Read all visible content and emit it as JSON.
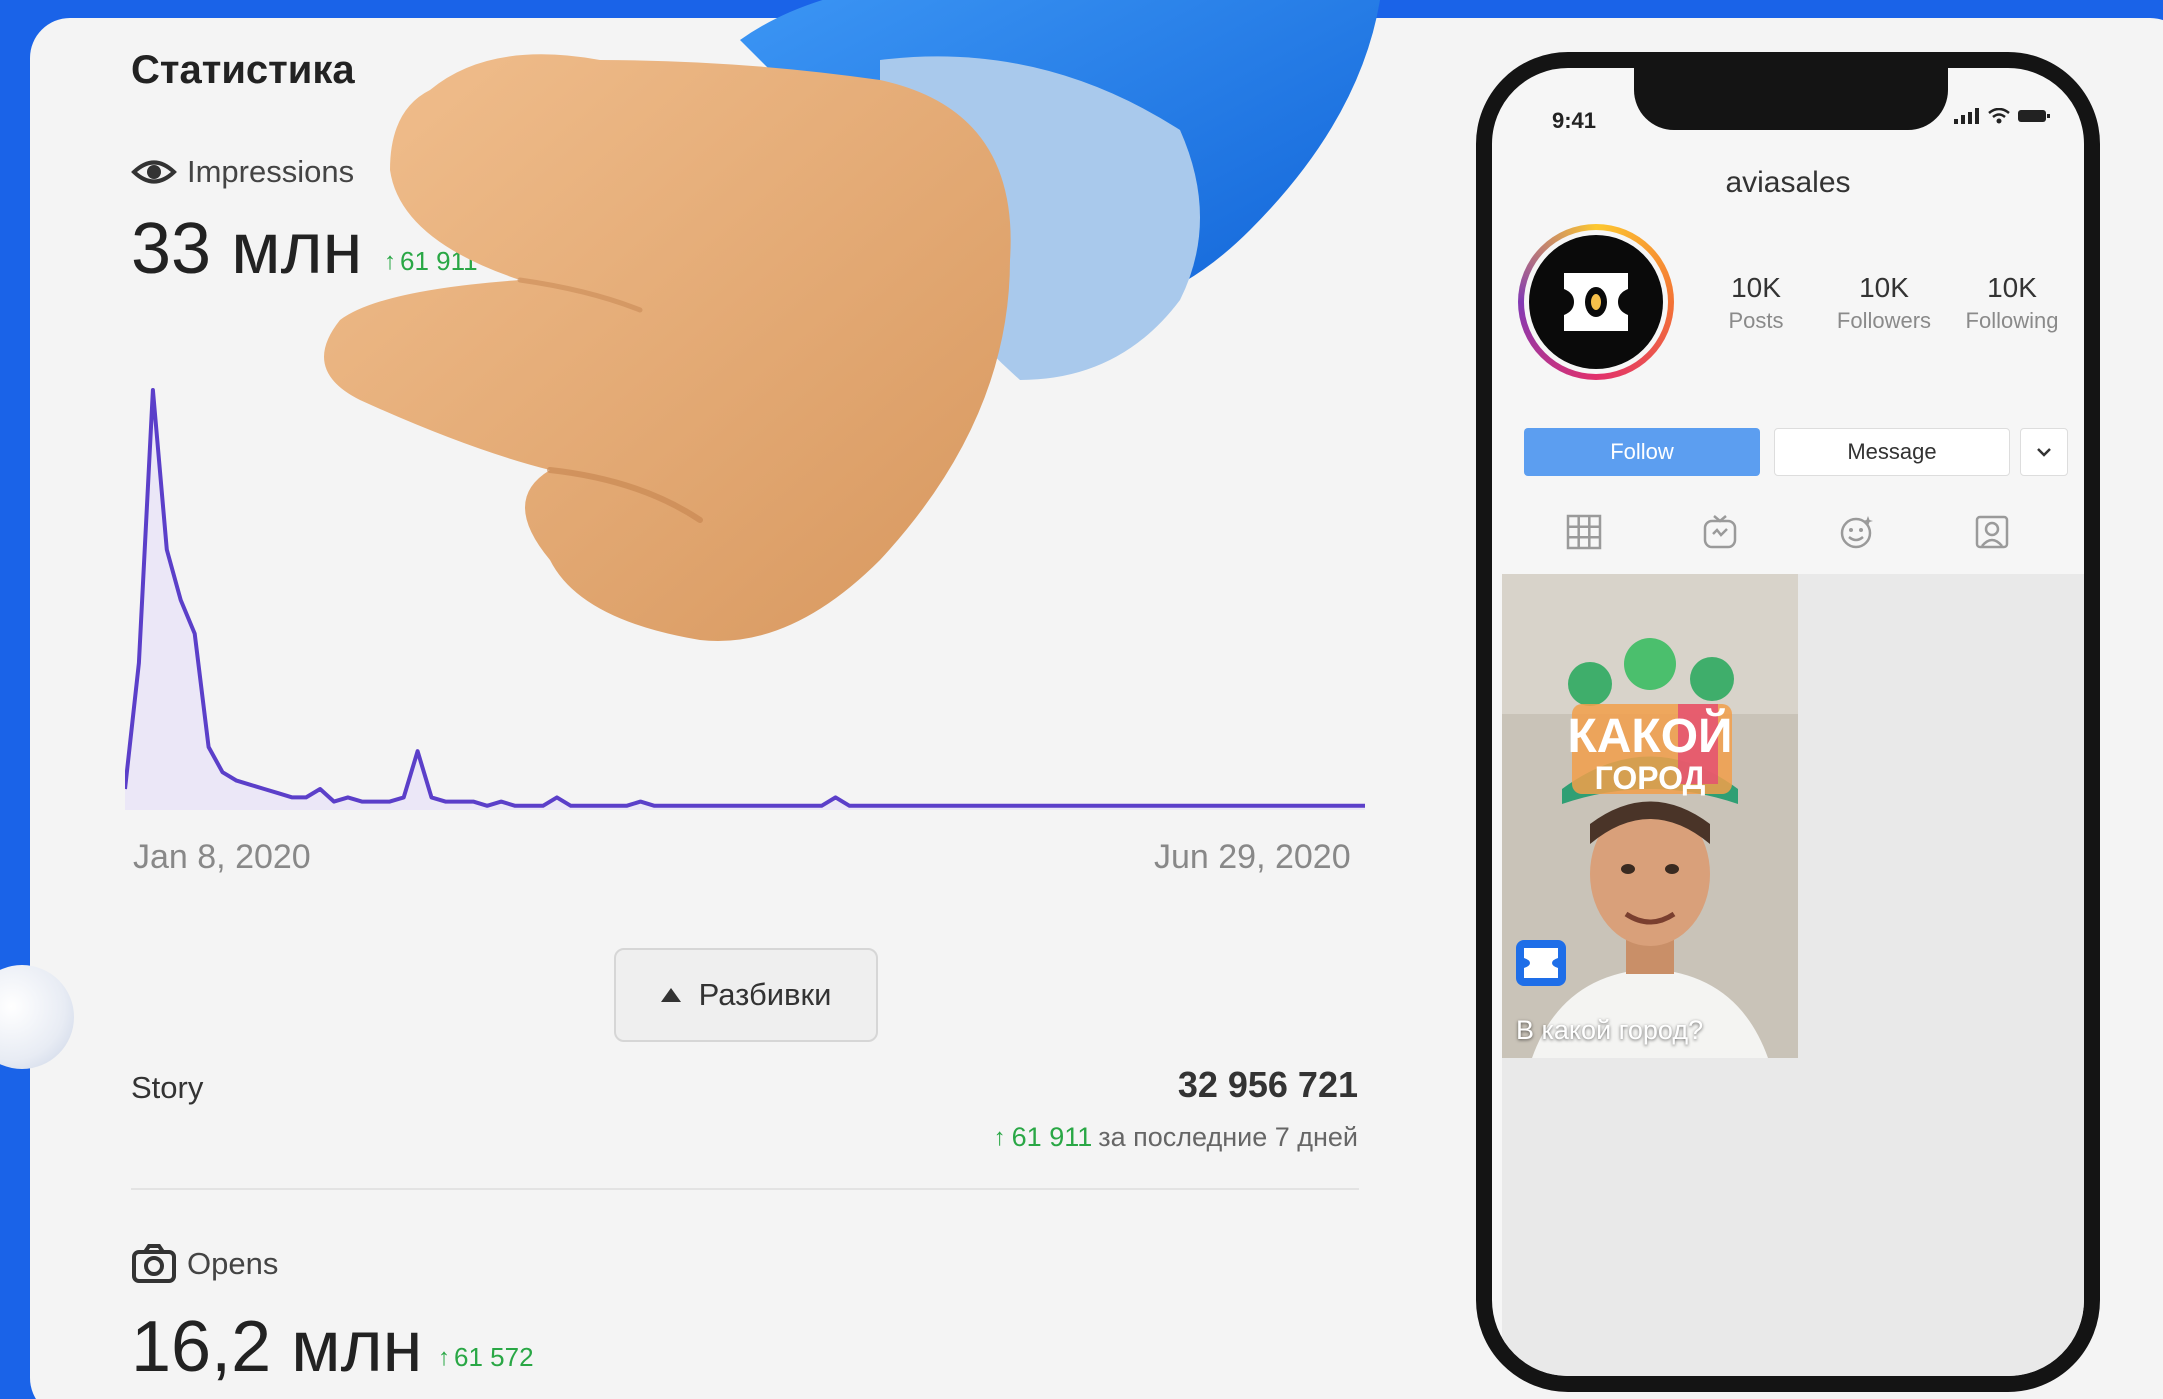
{
  "stats": {
    "title": "Статистика",
    "impressions": {
      "label": "Impressions",
      "value": "33 млн",
      "delta": "61 911"
    },
    "chart_data": {
      "type": "area",
      "x_start": "Jan 8, 2020",
      "x_end": "Jun 29, 2020",
      "tick_labels": [
        "Jan 8, 2020",
        "Jun 29, 2020"
      ],
      "color": "#5b3fc9",
      "values": [
        0.05,
        0.35,
        1.0,
        0.62,
        0.5,
        0.42,
        0.15,
        0.09,
        0.07,
        0.06,
        0.05,
        0.04,
        0.03,
        0.03,
        0.05,
        0.02,
        0.03,
        0.02,
        0.02,
        0.02,
        0.03,
        0.14,
        0.03,
        0.02,
        0.02,
        0.02,
        0.01,
        0.02,
        0.01,
        0.01,
        0.01,
        0.03,
        0.01,
        0.01,
        0.01,
        0.01,
        0.01,
        0.02,
        0.01,
        0.01,
        0.01,
        0.01,
        0.01,
        0.01,
        0.01,
        0.01,
        0.01,
        0.01,
        0.01,
        0.01,
        0.01,
        0.03,
        0.01,
        0.01,
        0.01,
        0.01,
        0.01,
        0.01,
        0.01,
        0.01,
        0.01,
        0.01,
        0.01,
        0.01,
        0.01,
        0.01,
        0.01,
        0.01,
        0.01,
        0.01,
        0.01,
        0.01,
        0.01,
        0.01,
        0.01,
        0.01,
        0.01,
        0.01,
        0.01,
        0.01,
        0.01,
        0.01,
        0.01,
        0.01,
        0.01,
        0.01,
        0.01,
        0.01,
        0.01,
        0.01
      ]
    },
    "breakdown_label": "Разбивки",
    "story": {
      "label": "Story",
      "value": "32 956 721",
      "delta": "61 911",
      "delta_note": "за последние 7 дней"
    },
    "opens": {
      "label": "Opens",
      "value": "16,2 млн",
      "delta": "61 572"
    }
  },
  "phone": {
    "time": "9:41",
    "username": "aviasales",
    "stats": [
      {
        "num": "10K",
        "label": "Posts"
      },
      {
        "num": "10K",
        "label": "Followers"
      },
      {
        "num": "10K",
        "label": "Following"
      }
    ],
    "follow_label": "Follow",
    "message_label": "Message",
    "post_caption": "В какой город?",
    "post_sticker_title": "КАКОЙ",
    "post_sticker_sub": "ГОРОД"
  },
  "colors": {
    "background": "#1a63e8",
    "chart_line": "#5b3fc9",
    "delta_green": "#29a745",
    "follow_blue": "#5c9ef0"
  }
}
